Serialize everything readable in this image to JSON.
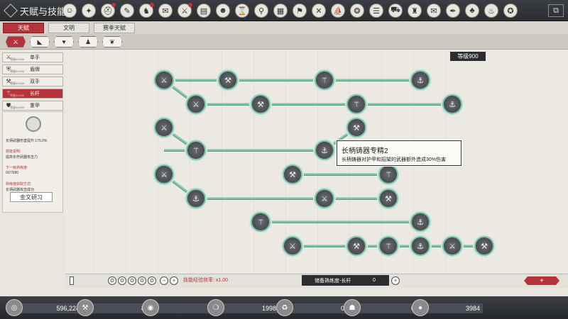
{
  "window": {
    "title": "天赋与技能"
  },
  "top_icons": [
    {
      "name": "character-icon",
      "glyph": "☺",
      "badge": false
    },
    {
      "name": "skills-icon",
      "glyph": "✦",
      "badge": false
    },
    {
      "name": "helmet-icon",
      "glyph": "⛑",
      "badge": true
    },
    {
      "name": "scroll-icon",
      "glyph": "✎",
      "badge": false
    },
    {
      "name": "horse-icon",
      "glyph": "♞",
      "badge": true
    },
    {
      "name": "tag-icon",
      "glyph": "✉",
      "badge": false
    },
    {
      "name": "sword-icon",
      "glyph": "⚔",
      "badge": true
    },
    {
      "name": "paper-icon",
      "glyph": "▤",
      "badge": false
    },
    {
      "name": "group-icon",
      "glyph": "☻",
      "badge": false
    },
    {
      "name": "hourglass-icon",
      "glyph": "⌛",
      "badge": false
    },
    {
      "name": "pin-icon",
      "glyph": "⚲",
      "badge": false
    },
    {
      "name": "building-icon",
      "glyph": "▦",
      "badge": false
    },
    {
      "name": "flag-icon",
      "glyph": "⚑",
      "badge": false
    },
    {
      "name": "crossed-icon",
      "glyph": "✕",
      "badge": false
    },
    {
      "name": "ship-icon",
      "glyph": "⛵",
      "badge": false
    },
    {
      "name": "wheel-icon",
      "glyph": "❂",
      "badge": false
    },
    {
      "name": "book-icon",
      "glyph": "☰",
      "badge": false
    },
    {
      "name": "cart-icon",
      "glyph": "⛟",
      "badge": false
    },
    {
      "name": "guard-icon",
      "glyph": "♜",
      "badge": false
    },
    {
      "name": "letter-icon",
      "glyph": "✉",
      "badge": false
    },
    {
      "name": "quill-icon",
      "glyph": "✒",
      "badge": false
    },
    {
      "name": "tree-icon",
      "glyph": "♣",
      "badge": false
    },
    {
      "name": "cup-icon",
      "glyph": "♨",
      "badge": false
    },
    {
      "name": "compass-icon",
      "glyph": "✪",
      "badge": false
    }
  ],
  "tabs": [
    "天赋",
    "文明",
    "赛季天赋"
  ],
  "filters": [
    {
      "name": "weapon-filter-icon",
      "glyph": "⚔",
      "active": true
    },
    {
      "name": "boot-filter-icon",
      "glyph": "◣",
      "active": false
    },
    {
      "name": "heart-filter-icon",
      "glyph": "♥",
      "active": false
    },
    {
      "name": "person-filter-icon",
      "glyph": "♟",
      "active": false
    },
    {
      "name": "tree-filter-icon",
      "glyph": "❦",
      "active": false
    }
  ],
  "weapon_categories": [
    {
      "label": "单手",
      "icon": "⚔",
      "active": false
    },
    {
      "label": "盾牌",
      "icon": "⛨",
      "active": false
    },
    {
      "label": "双手",
      "icon": "⚒",
      "active": false
    },
    {
      "label": "长杆",
      "icon": "⚚",
      "active": true
    },
    {
      "label": "重甲",
      "icon": "⛊",
      "active": false
    }
  ],
  "weapon_cat_level_label": "等级0/1000",
  "detail": {
    "bonus": "长柄武器伤害提升:175.0%",
    "desc_title": "技能说明:",
    "desc": "提高长杆武器攻击力",
    "next_title": "下一级熟练度:",
    "next_value": "0/27680",
    "method_title": "熟练度获取方式:",
    "method": "长柄武器攻击成功",
    "study_button": "金文研习"
  },
  "level_badge": "等级900",
  "tooltip": {
    "title": "长柄铸器专精2",
    "text": "长柄铸器对护甲和招架的武器额外造成30%伤害"
  },
  "lower_bar": {
    "efficiency": "技能经验效率: x1.00",
    "store_label": "储备熟练度-长杆",
    "store_value": "0"
  },
  "currencies": [
    {
      "name": "silver-coin-icon",
      "glyph": "◎",
      "value": "596,224"
    },
    {
      "name": "hammer-icon",
      "glyph": "⚒",
      "value": "8"
    },
    {
      "name": "ring-icon",
      "glyph": "◉",
      "value": "7"
    },
    {
      "name": "orb-icon",
      "glyph": "❍",
      "value": "19987"
    },
    {
      "name": "cycle-icon",
      "glyph": "♻",
      "value": "0"
    },
    {
      "name": "beast-icon",
      "glyph": "☗",
      "value": "0"
    },
    {
      "name": "gold-coin-icon",
      "glyph": "●",
      "value": "3984"
    }
  ],
  "colors": {
    "accent": "#b5333a",
    "link": "#7fc1a8",
    "dark": "#2b2d31"
  }
}
